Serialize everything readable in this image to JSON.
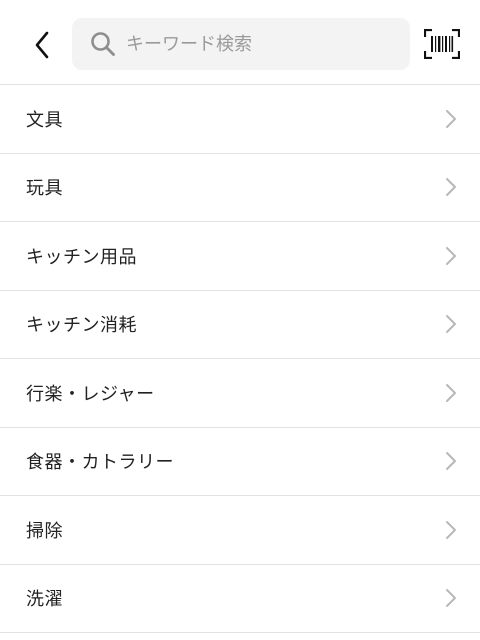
{
  "header": {
    "back_icon": "chevron-left-icon",
    "search": {
      "icon": "search-icon",
      "placeholder": "キーワード検索",
      "value": ""
    },
    "barcode_icon": "barcode-scan-icon"
  },
  "categories": [
    {
      "label": "文具"
    },
    {
      "label": "玩具"
    },
    {
      "label": "キッチン用品"
    },
    {
      "label": "キッチン消耗"
    },
    {
      "label": "行楽・レジャー"
    },
    {
      "label": "食器・カトラリー"
    },
    {
      "label": "掃除"
    },
    {
      "label": "洗濯"
    }
  ],
  "colors": {
    "text": "#222222",
    "placeholder": "#9a9a9a",
    "divider": "#e2e2e2",
    "search_bg": "#f3f3f3",
    "chevron": "#b8b8b8"
  }
}
